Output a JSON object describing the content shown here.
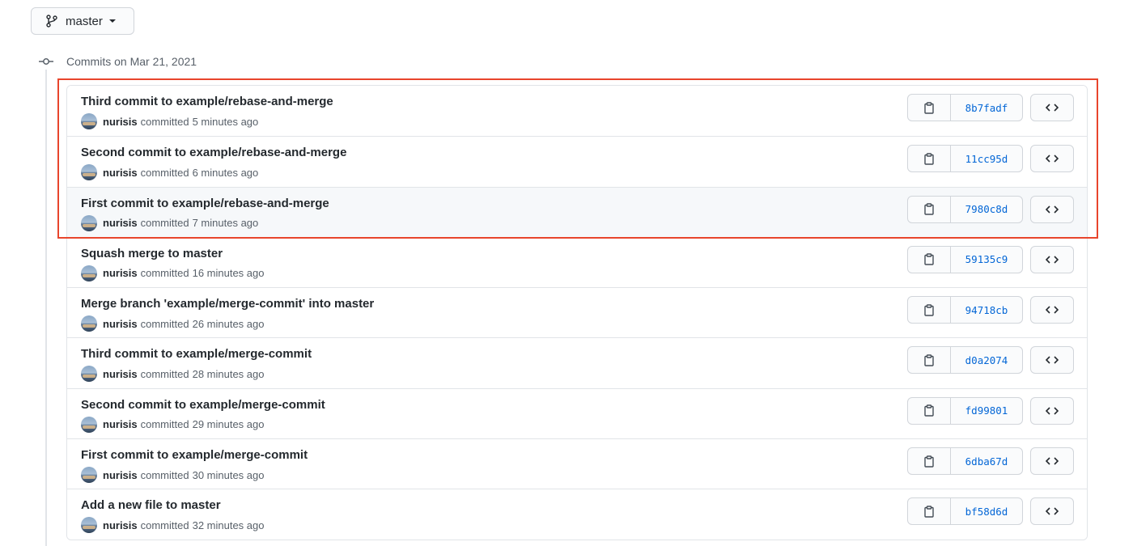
{
  "branch": {
    "name": "master",
    "icon": "git-branch-icon"
  },
  "timeline": {
    "heading": "Commits on Mar 21, 2021",
    "icon": "git-commit-icon"
  },
  "colors": {
    "highlight": "#e8452c",
    "link": "#0366d6"
  },
  "commits": [
    {
      "title": "Third commit to example/rebase-and-merge",
      "author": "nurisis",
      "action": "committed",
      "time": "5 minutes ago",
      "sha": "8b7fadf"
    },
    {
      "title": "Second commit to example/rebase-and-merge",
      "author": "nurisis",
      "action": "committed",
      "time": "6 minutes ago",
      "sha": "11cc95d"
    },
    {
      "title": "First commit to example/rebase-and-merge",
      "author": "nurisis",
      "action": "committed",
      "time": "7 minutes ago",
      "sha": "7980c8d"
    },
    {
      "title": "Squash merge to master",
      "author": "nurisis",
      "action": "committed",
      "time": "16 minutes ago",
      "sha": "59135c9"
    },
    {
      "title": "Merge branch 'example/merge-commit' into master",
      "author": "nurisis",
      "action": "committed",
      "time": "26 minutes ago",
      "sha": "94718cb"
    },
    {
      "title": "Third commit to example/merge-commit",
      "author": "nurisis",
      "action": "committed",
      "time": "28 minutes ago",
      "sha": "d0a2074"
    },
    {
      "title": "Second commit to example/merge-commit",
      "author": "nurisis",
      "action": "committed",
      "time": "29 minutes ago",
      "sha": "fd99801"
    },
    {
      "title": "First commit to example/merge-commit",
      "author": "nurisis",
      "action": "committed",
      "time": "30 minutes ago",
      "sha": "6dba67d"
    },
    {
      "title": "Add a new file to master",
      "author": "nurisis",
      "action": "committed",
      "time": "32 minutes ago",
      "sha": "bf58d6d"
    }
  ]
}
